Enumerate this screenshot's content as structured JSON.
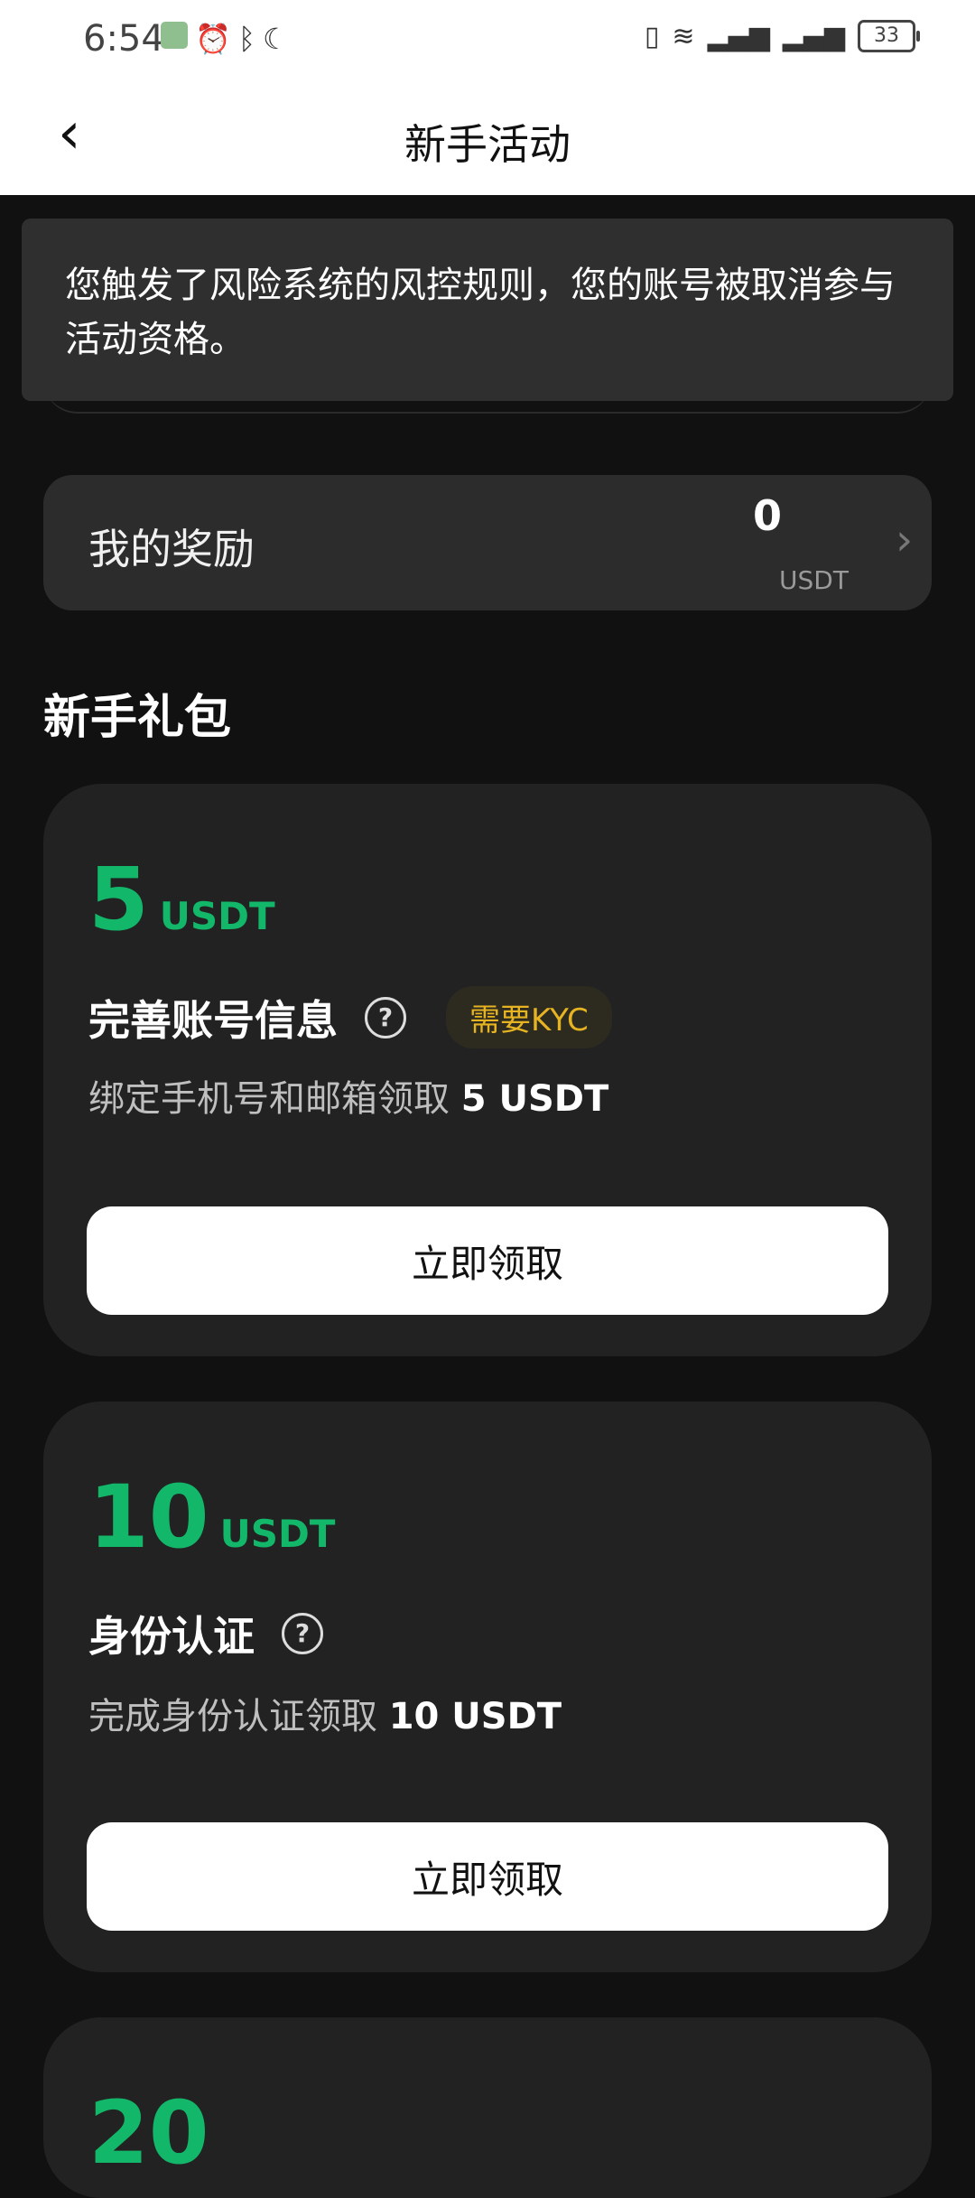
{
  "status_bar": {
    "time": "6:54",
    "battery": "33",
    "icons": [
      "app-icon",
      "alarm-icon",
      "bluetooth-icon",
      "moon-icon",
      "vibrate-icon",
      "wifi-icon",
      "signal-4g-icon",
      "signal-4g-icon-2"
    ]
  },
  "nav": {
    "title": "新手活动"
  },
  "toast": {
    "message": "您触发了风险系统的风控规则，您的账号被取消参与活动资格。"
  },
  "reward": {
    "label": "我的奖励",
    "amount": "0",
    "unit": "USDT"
  },
  "section": {
    "title": "新手礼包"
  },
  "cards": [
    {
      "amount": "5",
      "unit": "USDT",
      "title": "完善账号信息",
      "badge": "需要KYC",
      "desc_prefix": "绑定手机号和邮箱领取",
      "desc_value": "5 USDT",
      "button": "立即领取"
    },
    {
      "amount": "10",
      "unit": "USDT",
      "title": "身份认证",
      "desc_prefix": "完成身份认证领取",
      "desc_value": "10 USDT",
      "button": "立即领取"
    },
    {
      "amount": "20"
    }
  ],
  "colors": {
    "accent_green": "#12b76a",
    "badge_yellow": "#e6b422",
    "background": "#111111",
    "card": "#222222"
  }
}
